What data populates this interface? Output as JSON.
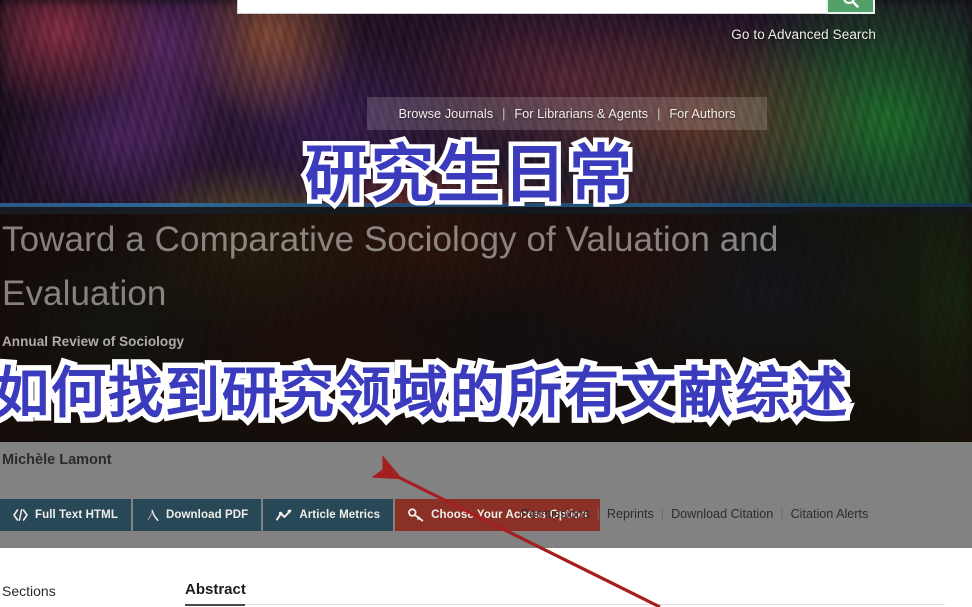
{
  "search": {
    "placeholder": "",
    "value": "",
    "button_icon": "search-icon",
    "advanced_link": "Go to Advanced Search"
  },
  "nav": {
    "items": [
      "Browse Journals",
      "For Librarians & Agents",
      "For Authors"
    ],
    "separator": "|"
  },
  "article": {
    "title": "Toward a Comparative Sociology of Valuation and Evaluation",
    "journal": "Annual Review of Sociology",
    "author": "Michèle Lamont"
  },
  "buttons": [
    {
      "label": "Full Text HTML",
      "icon": "code-icon",
      "style": "teal"
    },
    {
      "label": "Download PDF",
      "icon": "pdf-icon",
      "style": "teal"
    },
    {
      "label": "Article Metrics",
      "icon": "metrics-icon",
      "style": "teal"
    },
    {
      "label": "Choose Your Access Option",
      "icon": "key-icon",
      "style": "red"
    }
  ],
  "meta_links": [
    "Permissions",
    "Reprints",
    "Download Citation",
    "Citation Alerts"
  ],
  "content": {
    "sections_label": "Sections",
    "abstract_heading": "Abstract"
  },
  "overlay": {
    "title_cn": "研究生日常",
    "banner_cn": "如何找到研究领域的所有文献综述",
    "text_color": "#3b3bbd",
    "stroke_color": "#ffffff",
    "arrow_color": "#a51f1f"
  },
  "colors": {
    "teal_button": "#294857",
    "red_button": "#8a3026",
    "search_green": "#53a06b",
    "grey_overlay": "#828282"
  }
}
